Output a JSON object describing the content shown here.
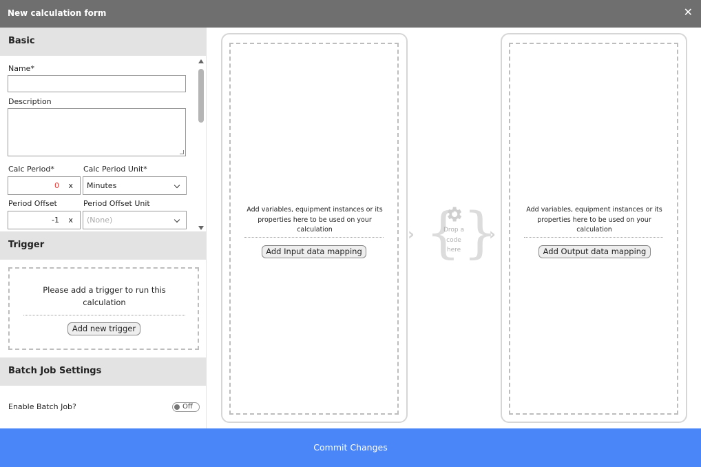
{
  "window": {
    "title": "New calculation form",
    "close_glyph": "✕"
  },
  "basic": {
    "heading": "Basic",
    "name_label": "Name*",
    "name_value": "",
    "description_label": "Description",
    "description_value": "",
    "calc_period_label": "Calc Period*",
    "calc_period_value": "0",
    "calc_period_clear": "x",
    "calc_period_unit_label": "Calc Period Unit*",
    "calc_period_unit_value": "Minutes",
    "period_offset_label": "Period Offset",
    "period_offset_value": "-1",
    "period_offset_clear": "x",
    "period_offset_unit_label": "Period Offset Unit",
    "period_offset_unit_value": "(None)"
  },
  "trigger": {
    "heading": "Trigger",
    "message": "Please add a trigger to run this calculation",
    "add_button": "Add new trigger"
  },
  "batch": {
    "heading": "Batch Job Settings",
    "enable_label": "Enable Batch Job?",
    "toggle_value": "Off"
  },
  "input_mapping": {
    "help": "Add variables, equipment instances or its properties here to be used on your calculation",
    "button": "Add Input data mapping"
  },
  "code_drop": {
    "text": "Drop a code here",
    "icon": "gear-icon",
    "arrow_glyph": "›"
  },
  "output_mapping": {
    "help": "Add variables, equipment instances or its properties here to be used on your calculation",
    "button": "Add Output data mapping"
  },
  "footer": {
    "commit_label": "Commit Changes"
  },
  "colors": {
    "titlebar": "#6f6f6f",
    "section_header": "#e3e3e3",
    "commit": "#4a86f7",
    "error_value": "#e53935"
  }
}
